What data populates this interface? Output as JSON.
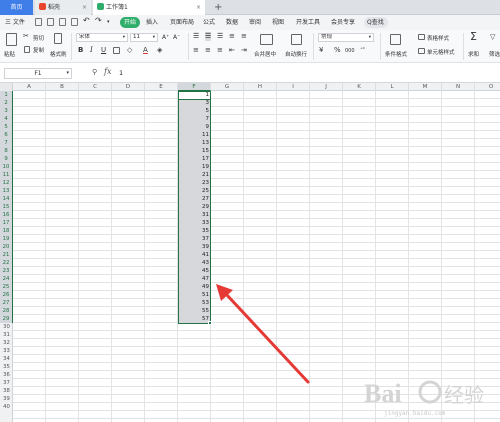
{
  "tabs": [
    {
      "label": "首页",
      "icon": "home-icon"
    },
    {
      "label": "稻壳",
      "icon": "docer-icon",
      "color": "#e8452c"
    },
    {
      "label": "工作簿1",
      "icon": "spreadsheet-icon",
      "color": "#2fae6b"
    }
  ],
  "tab_close": "×",
  "new_tab": "+",
  "menu": {
    "file": "三 文件",
    "items": [
      "开始",
      "插入",
      "页面布局",
      "公式",
      "数据",
      "审阅",
      "视图",
      "开发工具",
      "会员专享"
    ],
    "search": "Q查找"
  },
  "ribbon": {
    "paste": "粘贴",
    "cut": "剪切",
    "copy": "复制",
    "format_painter": "格式刷",
    "font_name": "宋体",
    "font_size": "11",
    "bold": "B",
    "italic": "I",
    "underline": "U",
    "font_grow": "A⁺",
    "font_shrink": "A⁻",
    "merge_center": "合并居中",
    "wrap_text": "自动换行",
    "number_format": "常规",
    "currency": "¥",
    "percent": "%",
    "thousands": "000",
    "conditional_format": "条件格式",
    "table_style": "表格样式",
    "cell_style": "单元格样式",
    "sum": "求和",
    "filter": "筛选"
  },
  "formula_bar": {
    "name_box": "F1",
    "fx": "fx",
    "value": "1"
  },
  "columns": [
    "A",
    "B",
    "C",
    "D",
    "E",
    "F",
    "G",
    "H",
    "I",
    "J",
    "K",
    "L",
    "M",
    "N",
    "O"
  ],
  "selected_column": "F",
  "rows": [
    "1",
    "2",
    "3",
    "4",
    "5",
    "6",
    "7",
    "8",
    "9",
    "10",
    "11",
    "12",
    "13",
    "14",
    "15",
    "16",
    "17",
    "18",
    "19",
    "20",
    "21",
    "22",
    "23",
    "24",
    "25",
    "26",
    "27",
    "28",
    "29",
    "30",
    "31",
    "32",
    "33",
    "34",
    "35",
    "36",
    "37",
    "38",
    "39",
    "40"
  ],
  "column_f_values": [
    "1",
    "3",
    "5",
    "7",
    "9",
    "11",
    "13",
    "15",
    "17",
    "19",
    "21",
    "23",
    "25",
    "27",
    "29",
    "31",
    "33",
    "35",
    "37",
    "39",
    "41",
    "43",
    "45",
    "47",
    "49",
    "51",
    "53",
    "55",
    "57"
  ],
  "watermark": "jingyan.baidu.com",
  "colors": {
    "accent_green": "#217346",
    "start_tab": "#2fae6b",
    "home_tab": "#3f7de9",
    "arrow_red": "#e53935"
  }
}
